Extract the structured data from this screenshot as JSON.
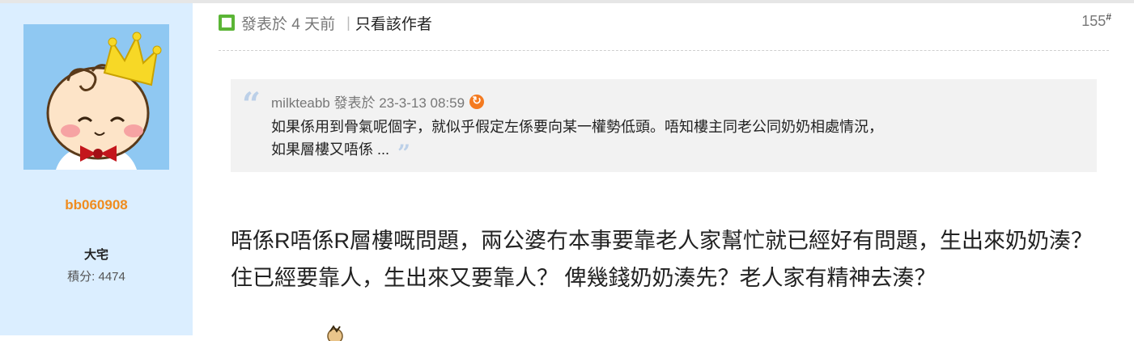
{
  "user": {
    "username": "bb060908",
    "rank": "大宅",
    "points_label": "積分: 4474",
    "avatar_icon": "baby-king-avatar-icon"
  },
  "post": {
    "posted_label": "發表於 4 天前",
    "separator": "|",
    "author_only_label": "只看該作者",
    "floor_number": "155",
    "floor_mark": "#",
    "quote": {
      "author_line": "milkteabb 發表於 23-3-13 08:59",
      "text_line1": "如果係用到骨氣呢個字，就似乎假定左係要向某一權勢低頭。唔知樓主同老公同奶奶相處情況，",
      "text_line2": "如果層樓又唔係 ..."
    },
    "body": "唔係R唔係R層樓嘅問題，兩公婆冇本事要靠老人家幫忙就已經好有問題，生出來奶奶湊？住已經要靠人，生出來又要靠人？ 俾幾錢奶奶湊先？老人家有精神去湊？"
  },
  "colors": {
    "sidebar_bg": "#dbeeff",
    "username": "#f08c1e",
    "post_icon": "#5bb536",
    "quote_bg": "#f2f2f2"
  }
}
